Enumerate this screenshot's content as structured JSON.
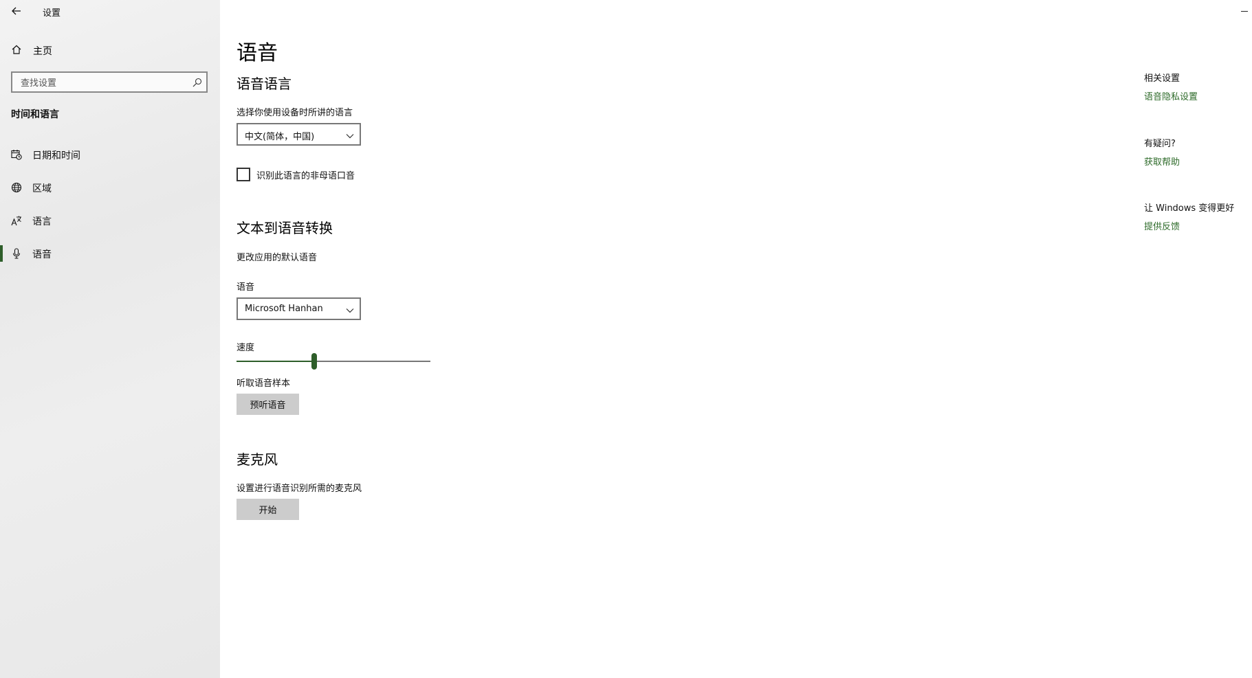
{
  "window": {
    "app_title": "设置"
  },
  "sidebar": {
    "home_label": "主页",
    "search_placeholder": "查找设置",
    "section_title": "时间和语言",
    "items": [
      {
        "label": "日期和时间",
        "icon": "calendar-clock-icon"
      },
      {
        "label": "区域",
        "icon": "globe-icon"
      },
      {
        "label": "语言",
        "icon": "language-icon"
      },
      {
        "label": "语音",
        "icon": "microphone-icon",
        "selected": true
      }
    ]
  },
  "main": {
    "title": "语音",
    "speech_language": {
      "heading": "语音语言",
      "select_label": "选择你使用设备时所讲的语言",
      "select_value": "中文(简体，中国)",
      "checkbox_label": "识别此语言的非母语口音",
      "checkbox_checked": false
    },
    "tts": {
      "heading": "文本到语音转换",
      "description": "更改应用的默认语音",
      "voice_label": "语音",
      "voice_value": "Microsoft Hanhan",
      "speed_label": "速度",
      "speed_fraction": 0.4,
      "sample_label": "听取语音样本",
      "preview_button": "预听语音"
    },
    "microphone": {
      "heading": "麦克风",
      "description": "设置进行语音识别所需的麦克风",
      "start_button": "开始"
    }
  },
  "related": {
    "heading": "相关设置",
    "link_privacy": "语音隐私设置",
    "question_heading": "有疑问?",
    "link_help": "获取帮助",
    "feedback_heading": "让 Windows 变得更好",
    "link_feedback": "提供反馈"
  },
  "colors": {
    "accent": "#2e5e2a",
    "link": "#2e6b2a",
    "button_bg": "#cccccc",
    "sidebar_bg": "#eeeeee"
  }
}
